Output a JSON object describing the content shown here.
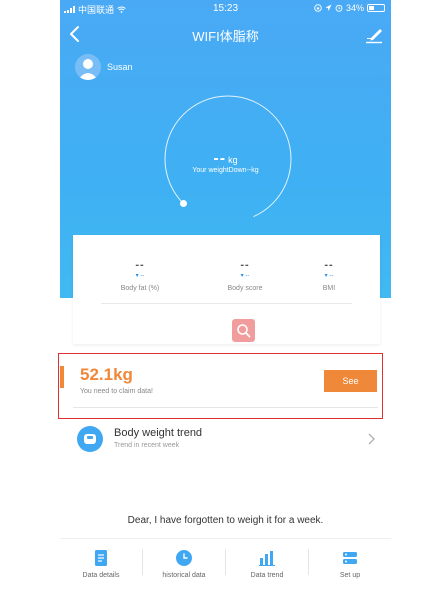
{
  "status_bar": {
    "carrier": "中国联通",
    "time": "15:23",
    "battery": "34%"
  },
  "nav": {
    "title": "WIFI体脂称",
    "back_icon": "chevron-left-icon",
    "edit_icon": "edit-pen-icon"
  },
  "user": {
    "name": "Susan"
  },
  "gauge": {
    "value": "--",
    "unit": "kg",
    "caption": "Your weightDown--kg"
  },
  "metrics": [
    {
      "value": "--",
      "delta": "--",
      "label": "Body fat (%)"
    },
    {
      "value": "--",
      "delta": "--",
      "label": "Body score"
    },
    {
      "value": "--",
      "delta": "--",
      "label": "BMI"
    }
  ],
  "claim": {
    "weight": "52.1kg",
    "message": "You need to claim data!",
    "button_label": "See"
  },
  "trend": {
    "title": "Body weight trend",
    "subtitle": "Trend in recent week"
  },
  "reminder": "Dear, I have forgotten to weigh it for a week.",
  "tabs": [
    {
      "label": "Data details",
      "icon": "document-icon"
    },
    {
      "label": "historical data",
      "icon": "clock-icon"
    },
    {
      "label": "Data trend",
      "icon": "bar-chart-icon"
    },
    {
      "label": "Set up",
      "icon": "settings-icon"
    }
  ],
  "colors": {
    "primary": "#40a9f3",
    "accent": "#f0883a",
    "highlight_border": "#e03030",
    "search_button": "#f19d9d"
  }
}
